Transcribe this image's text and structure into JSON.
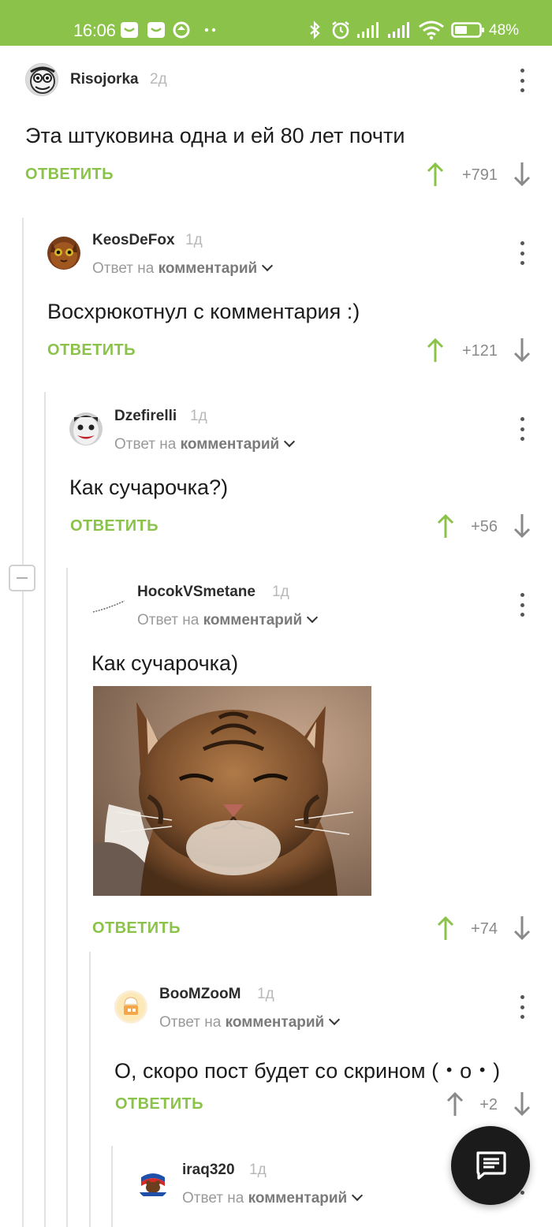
{
  "status_bar": {
    "time": "16:06",
    "battery": "48%"
  },
  "ui": {
    "reply_label": "ОТВЕТИТЬ",
    "reply_to_prefix": "Ответ на",
    "reply_to_target": "комментарий"
  },
  "comments": [
    {
      "author": "Risojorka",
      "age": "2д",
      "text": "Эта штуковина одна и ей 80 лет почти",
      "score": "+791"
    },
    {
      "author": "KeosDeFox",
      "age": "1д",
      "text": "Восхрюкотнул с комментария :)",
      "score": "+121"
    },
    {
      "author": "Dzefirelli",
      "age": "1д",
      "text": "Как сучарочка?)",
      "score": "+56"
    },
    {
      "author": "HocokVSmetane",
      "age": "1д",
      "text": "Как сучарочка)",
      "score": "+74"
    },
    {
      "author": "BooMZooM",
      "age": "1д",
      "text": "О, скоро пост будет со скрином (・o・)",
      "score": "+2"
    },
    {
      "author": "iraq320",
      "age": "1д"
    }
  ],
  "colors": {
    "accent": "#8bc34a",
    "vote_neutral": "#8a8a8a"
  }
}
